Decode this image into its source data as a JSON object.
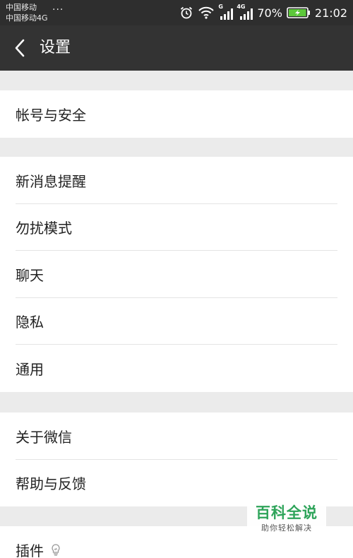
{
  "status_bar": {
    "carrier_1": "中国移动",
    "carrier_2": "中国移动4G",
    "overflow": "···",
    "signal_1_label": "G",
    "signal_2_label": "4G",
    "battery_percent": "70%",
    "time": "21:02"
  },
  "header": {
    "title": "设置"
  },
  "groups": [
    {
      "items": [
        "帐号与安全"
      ]
    },
    {
      "items": [
        "新消息提醒",
        "勿扰模式",
        "聊天",
        "隐私",
        "通用"
      ]
    },
    {
      "items": [
        "关于微信",
        "帮助与反馈"
      ]
    },
    {
      "items": [
        "插件"
      ]
    }
  ],
  "watermark": {
    "logo": "百科全说",
    "tagline": "助你轻松解决"
  },
  "colors": {
    "status_bar_bg": "#2e2e2e",
    "title_bar_bg": "#333333",
    "page_bg": "#ebebeb",
    "battery_charging": "#5cc83a",
    "watermark_green": "#2ea45a"
  },
  "icons": {
    "back": "chevron-left-icon",
    "plugin_hint": "lightbulb-icon"
  }
}
